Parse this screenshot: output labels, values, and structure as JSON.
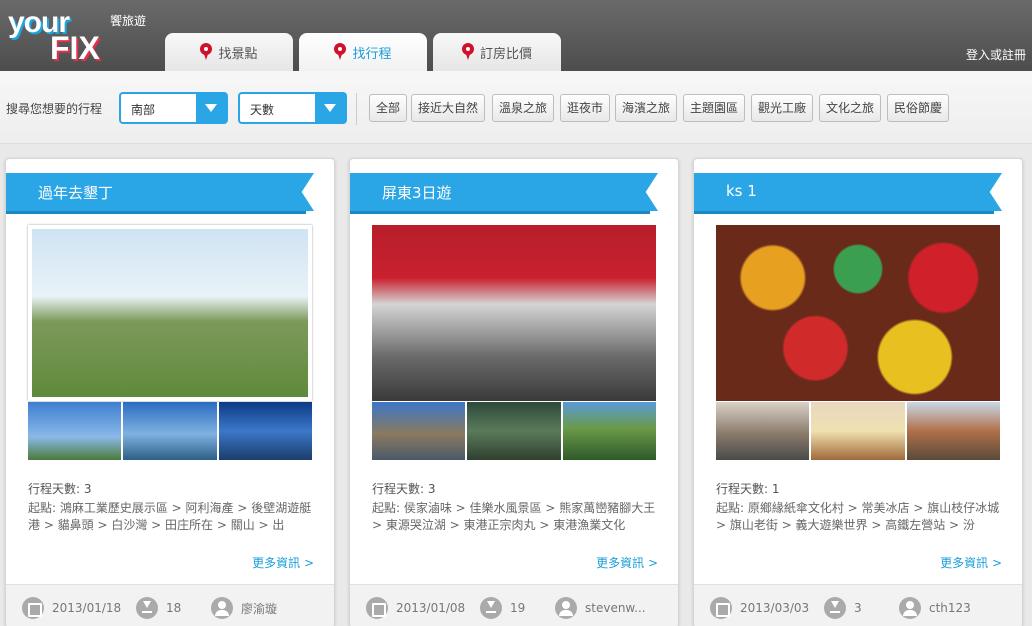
{
  "header": {
    "logo_your": "your",
    "logo_fix": "FIX",
    "logo_tagline": "饗旅遊",
    "login": "登入或註冊",
    "tabs": [
      {
        "label": "找景點",
        "active": false
      },
      {
        "label": "找行程",
        "active": true
      },
      {
        "label": "訂房比價",
        "active": false
      }
    ]
  },
  "filter": {
    "label": "搜尋您想要的行程",
    "region_value": "南部",
    "days_value": "天數",
    "categories": [
      "全部",
      "接近大自然",
      "溫泉之旅",
      "逛夜市",
      "海濱之旅",
      "主題園區",
      "觀光工廠",
      "文化之旅",
      "民俗節慶"
    ]
  },
  "colors": {
    "accent": "#2aa6e6",
    "link": "#1a9ed9",
    "pin": "#d0112b"
  },
  "cards": [
    {
      "title": "過年去墾丁",
      "days": "行程天數: 3",
      "route": "起點: 鴻麻工業歷史展示區 > 阿利海產 > 後壁湖遊艇港 > 貓鼻頭 > 白沙灣 > 田庄所在 > 關山 > 出",
      "more": "更多資訊 >",
      "date": "2013/01/18",
      "downloads": "18",
      "author": "廖渝璇"
    },
    {
      "title": "屏東3日遊",
      "days": "行程天數: 3",
      "route": "起點: 侯家滷味 > 佳樂水風景區 > 熊家萬巒豬腳大王 > 東源哭泣湖 > 東港正宗肉丸 > 東港漁業文化",
      "more": "更多資訊 >",
      "date": "2013/01/08",
      "downloads": "19",
      "author": "stevenw..."
    },
    {
      "title": "ks 1",
      "days": "行程天數: 1",
      "route": "起點: 原鄉緣紙傘文化村 > 常美冰店 > 旗山枝仔冰城 > 旗山老街 > 義大遊樂世界 > 高鐵左營站 > 汾",
      "more": "更多資訊 >",
      "date": "2013/03/03",
      "downloads": "3",
      "author": "cth123"
    }
  ]
}
